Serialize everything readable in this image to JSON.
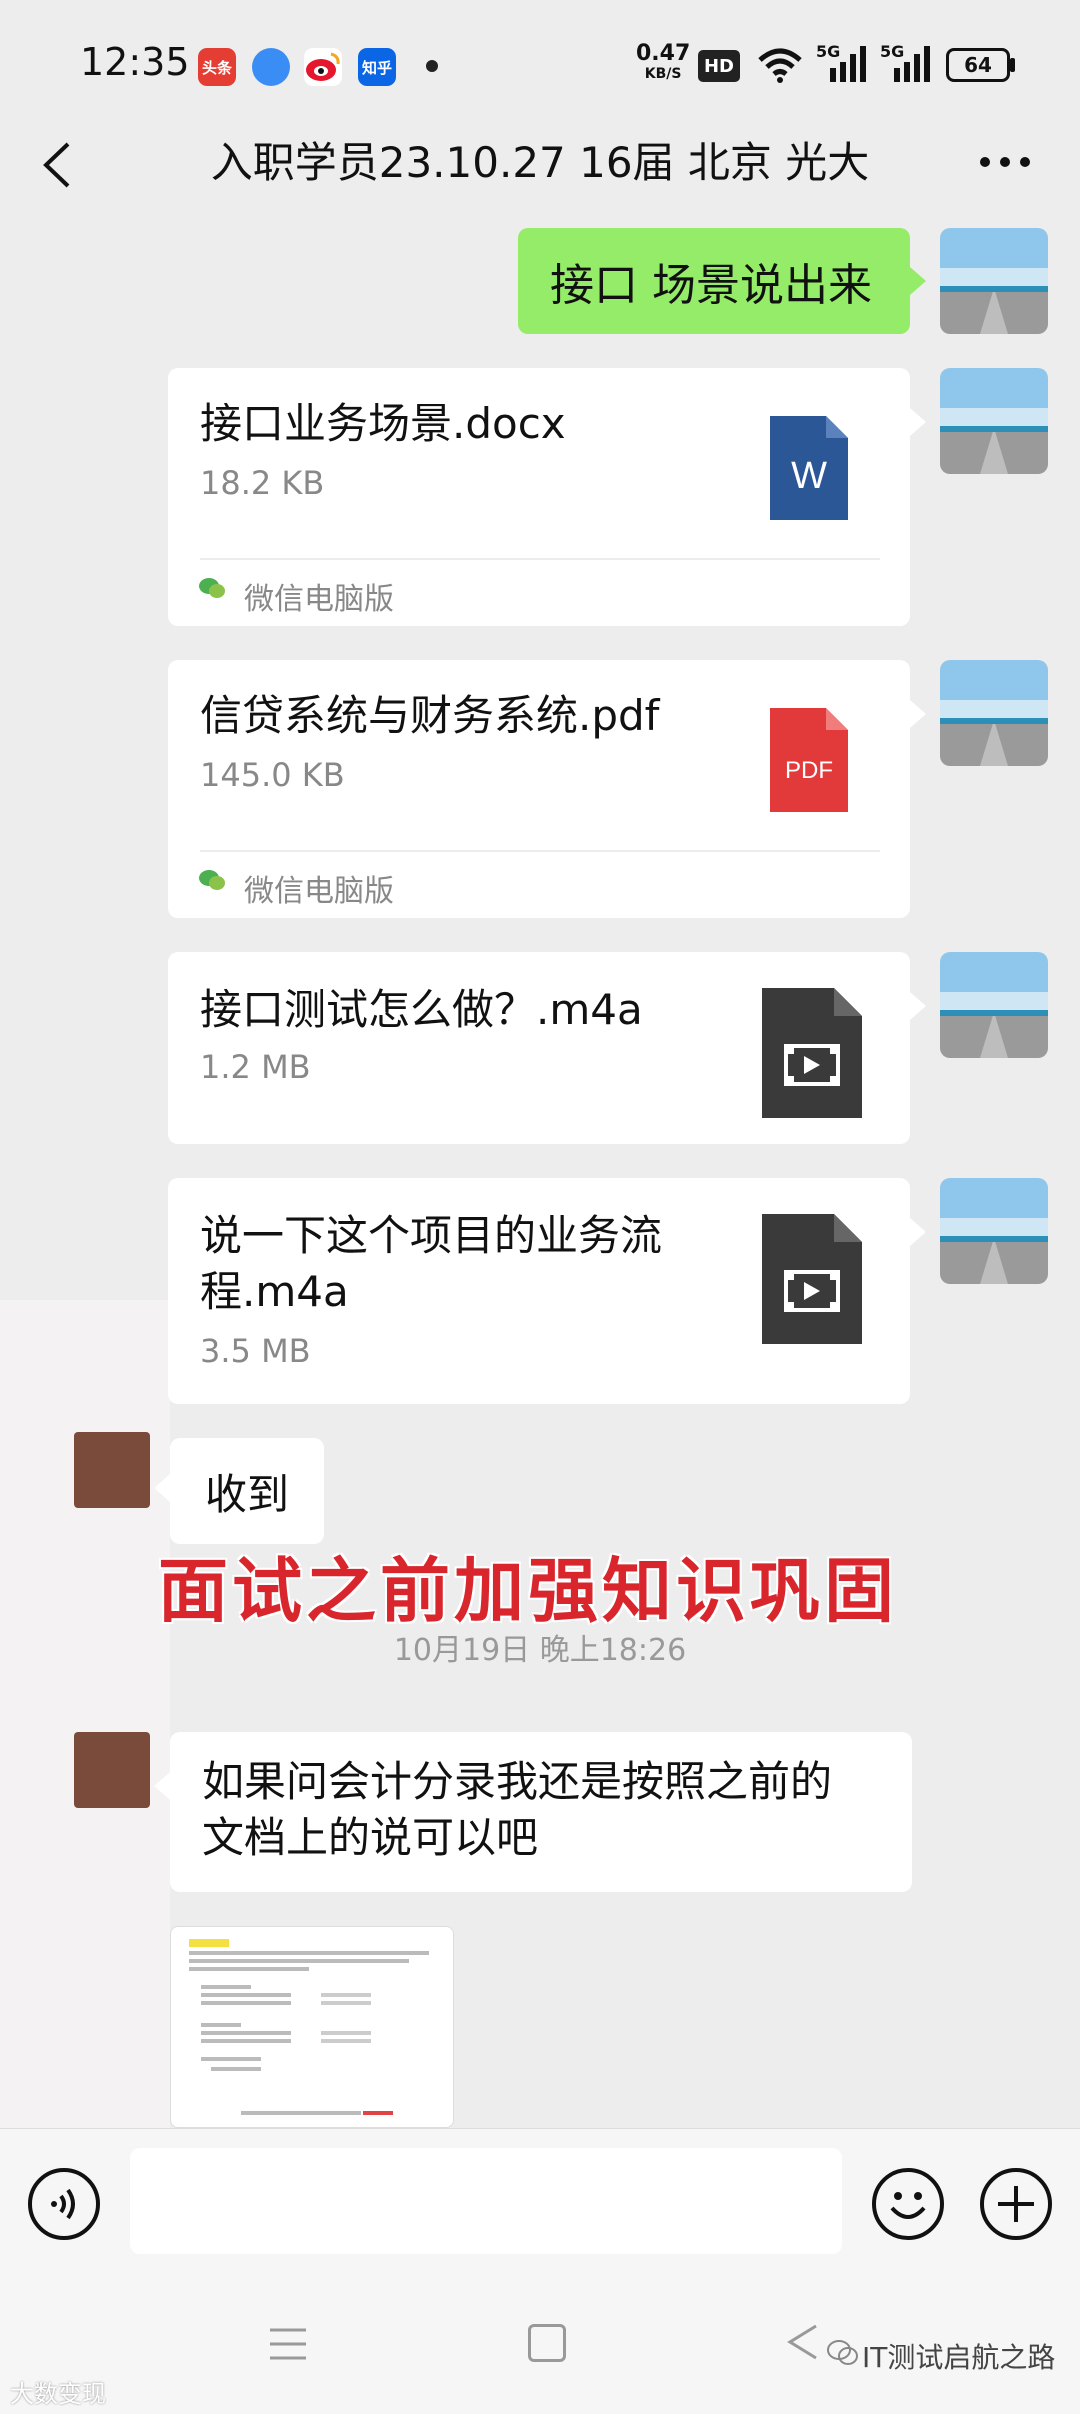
{
  "status": {
    "time": "12:35",
    "apps": [
      {
        "name": "toutiao-icon",
        "label": "头条",
        "color": "#e43d33"
      },
      {
        "name": "app-blue-icon",
        "label": "",
        "color": "#3a8df5"
      },
      {
        "name": "weibo-icon",
        "label": "",
        "color": "#e6162d"
      },
      {
        "name": "zhihu-icon",
        "label": "知乎",
        "color": "#0a66e4"
      }
    ],
    "speed": "0.47",
    "speed_unit": "KB/S",
    "hd": "HD",
    "net1": "5G",
    "net2": "5G",
    "battery": "64"
  },
  "header": {
    "title": "入职学员23.10.27 16届 北京 光大"
  },
  "messages": {
    "m1": {
      "text": "接口 场景说出来"
    },
    "m2": {
      "filename": "接口业务场景.docx",
      "size": "18.2 KB",
      "source": "微信电脑版",
      "icon_label": "W",
      "icon_color": "#2b5797"
    },
    "m3": {
      "filename": "信贷系统与财务系统.pdf",
      "size": "145.0 KB",
      "source": "微信电脑版",
      "icon_label": "PDF",
      "icon_color": "#e23a3a"
    },
    "m4": {
      "filename": "接口测试怎么做？.m4a",
      "size": "1.2 MB"
    },
    "m5": {
      "filename_line1": "说一下这个项目的业务流",
      "filename_line2": "程.m4a",
      "size": "3.5 MB"
    },
    "m6": {
      "text": "收到"
    },
    "m7": {
      "line1": "如果问会计分录我还是按照之前的",
      "line2": "文档上的说可以吧"
    }
  },
  "overlay_text": "面试之前加强知识巩固",
  "timestamp": "10月19日 晚上18:26",
  "watermarks": {
    "left": "大数变现",
    "right": "IT测试启航之路"
  },
  "colors": {
    "green_bubble": "#95ec69",
    "background": "#ededed",
    "overlay_red": "#d8262c"
  }
}
